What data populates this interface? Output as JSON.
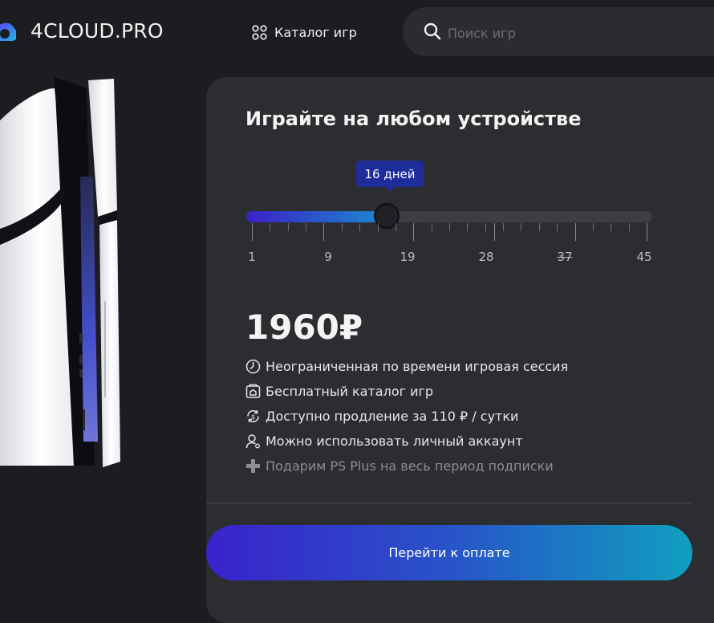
{
  "header": {
    "logo_text": "4CLOUD.PRO",
    "catalog_label": "Каталог игр",
    "search_placeholder": "Поиск игр"
  },
  "panel": {
    "title": "Играйте на любом устройстве",
    "slider": {
      "tooltip": "16 дней",
      "value": 16,
      "min": 1,
      "max": 45,
      "tick_labels": [
        "1",
        "9",
        "19",
        "28",
        "37",
        "45"
      ]
    },
    "price": "1960₽",
    "features": [
      {
        "icon": "clock-icon",
        "text": "Неограниченная по времени игровая сессия"
      },
      {
        "icon": "catalog-home-icon",
        "text": "Бесплатный каталог игр"
      },
      {
        "icon": "renew-currency-icon",
        "text": "Доступно продление за 110 ₽ / сутки"
      },
      {
        "icon": "user-icon",
        "text": "Можно использовать личный аккаунт"
      },
      {
        "icon": "playstation-plus-icon",
        "text": "Подарим PS Plus на весь период подписки"
      }
    ],
    "pay_button": "Перейти к оплате"
  },
  "colors": {
    "accent_start": "#3a22cc",
    "accent_end": "#0f9fc0",
    "tooltip_bg": "#1f2d9a",
    "panel_bg": "#2b2d30",
    "page_bg": "#1b1d20"
  }
}
